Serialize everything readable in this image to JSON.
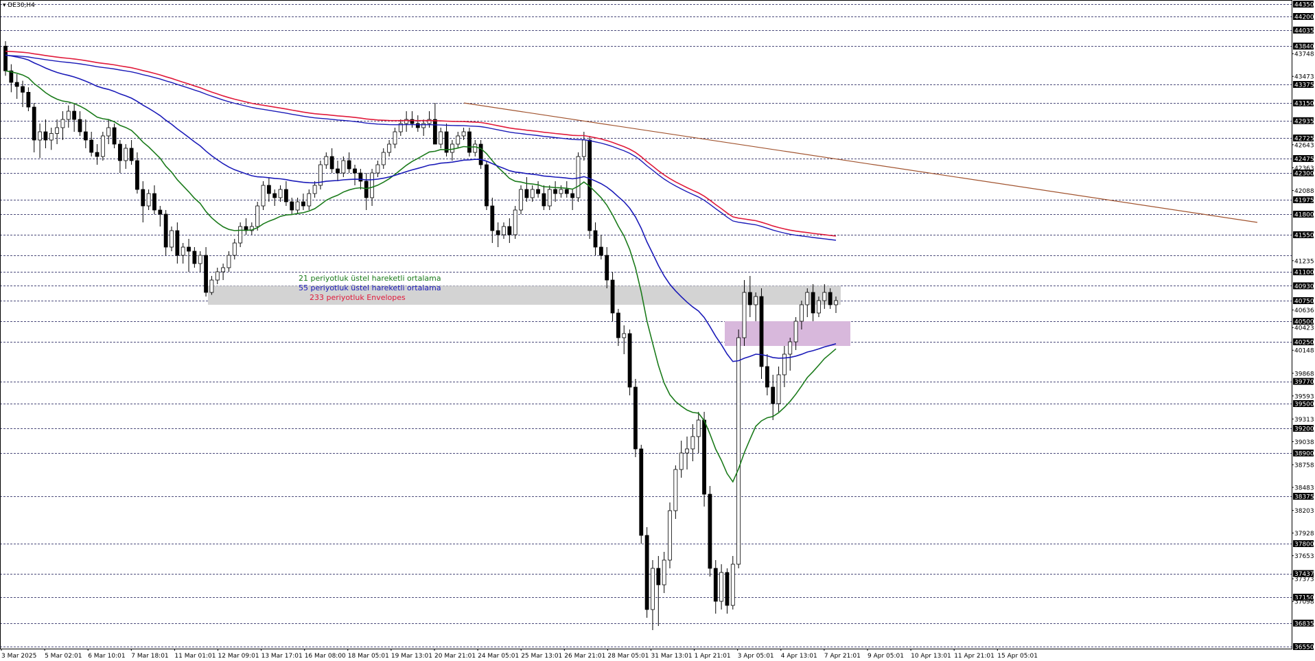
{
  "chart_data": {
    "type": "candlestick",
    "symbol": "DE30,H4",
    "y_tick_labels": [
      44350,
      44200,
      44035,
      43840,
      43748,
      43473,
      43375,
      43150,
      42935,
      42725,
      42643,
      42475,
      42363,
      42300,
      42088,
      41975,
      41800,
      41550,
      41235,
      41100,
      40930,
      40750,
      40636,
      40500,
      40423,
      40250,
      40148,
      39868,
      39770,
      39593,
      39500,
      39313,
      39200,
      39038,
      38900,
      38758,
      38483,
      38375,
      38203,
      37928,
      37800,
      37653,
      37437,
      37373,
      37150,
      37098,
      36835,
      36550
    ],
    "y_highlighted_levels": [
      44350,
      44200,
      44035,
      43840,
      43375,
      43150,
      42935,
      42725,
      42475,
      42300,
      41975,
      41800,
      41550,
      41300,
      41100,
      40930,
      40750,
      40500,
      40250,
      39770,
      39500,
      39200,
      38900,
      38375,
      37800,
      37437,
      37150,
      36835,
      36550
    ],
    "ylim": [
      36550,
      44350
    ],
    "x_tick_labels": [
      "3 Mar 2025",
      "5 Mar 02:01",
      "6 Mar 10:01",
      "7 Mar 18:01",
      "11 Mar 01:01",
      "12 Mar 09:01",
      "13 Mar 17:01",
      "16 Mar 08:00",
      "18 Mar 05:01",
      "19 Mar 13:01",
      "20 Mar 21:01",
      "24 Mar 05:01",
      "25 Mar 13:01",
      "26 Mar 21:01",
      "28 Mar 05:01",
      "31 Mar 13:01",
      "1 Apr 21:01",
      "3 Apr 05:01",
      "4 Apr 13:01",
      "7 Apr 21:01",
      "9 Apr 05:01",
      "10 Apr 13:01",
      "11 Apr 21:01",
      "15 Apr 05:01"
    ],
    "grid": true,
    "colors": {
      "bull_body": "#ffffff",
      "bear_body": "#000000",
      "wick": "#000000",
      "ema21": "#1a7a1a",
      "ema55": "#1a1ab8",
      "envelope": "#e0193a",
      "trendline": "#a0522d",
      "support_zone": "#d3d3d3",
      "demand_zone": "#d8b8dc",
      "highlight_label_bg": "#000000"
    },
    "legend": [
      {
        "text": "21 periyotluk üstel hareketli ortalama",
        "color": "#1a7a1a"
      },
      {
        "text": "55 periyotluk üstel hareketli ortalama",
        "color": "#1a1ab8"
      },
      {
        "text": "233 periyotluk Envelopes",
        "color": "#e0193a"
      }
    ],
    "candles_ohlc": [
      [
        43840,
        43900,
        43480,
        43540
      ],
      [
        43540,
        43620,
        43280,
        43400
      ],
      [
        43400,
        43500,
        43200,
        43350
      ],
      [
        43350,
        43420,
        43100,
        43280
      ],
      [
        43280,
        43340,
        43050,
        43100
      ],
      [
        43100,
        43150,
        42550,
        42700
      ],
      [
        42700,
        42900,
        42480,
        42800
      ],
      [
        42800,
        42950,
        42600,
        42700
      ],
      [
        42700,
        42850,
        42580,
        42780
      ],
      [
        42780,
        42950,
        42650,
        42850
      ],
      [
        42850,
        43050,
        42700,
        42950
      ],
      [
        42950,
        43120,
        42850,
        43050
      ],
      [
        43050,
        43150,
        42800,
        42950
      ],
      [
        42950,
        43050,
        42750,
        42800
      ],
      [
        42800,
        42950,
        42600,
        42700
      ],
      [
        42700,
        42800,
        42500,
        42550
      ],
      [
        42550,
        42650,
        42400,
        42500
      ],
      [
        42500,
        42800,
        42450,
        42750
      ],
      [
        42750,
        42950,
        42650,
        42850
      ],
      [
        42850,
        42900,
        42600,
        42650
      ],
      [
        42650,
        42700,
        42300,
        42450
      ],
      [
        42450,
        42650,
        42350,
        42600
      ],
      [
        42600,
        42700,
        42400,
        42450
      ],
      [
        42450,
        42550,
        42050,
        42100
      ],
      [
        42100,
        42200,
        41700,
        41900
      ],
      [
        41900,
        42100,
        41850,
        42050
      ],
      [
        42050,
        42150,
        41800,
        41850
      ],
      [
        41850,
        41900,
        41650,
        41800
      ],
      [
        41800,
        41850,
        41300,
        41400
      ],
      [
        41400,
        41650,
        41350,
        41600
      ],
      [
        41600,
        41700,
        41200,
        41300
      ],
      [
        41300,
        41450,
        41200,
        41400
      ],
      [
        41400,
        41500,
        41100,
        41350
      ],
      [
        41350,
        41400,
        41150,
        41200
      ],
      [
        41200,
        41350,
        41100,
        41300
      ],
      [
        41300,
        41400,
        40800,
        40850
      ],
      [
        40850,
        41050,
        40820,
        41000
      ],
      [
        41000,
        41150,
        40950,
        41100
      ],
      [
        41100,
        41200,
        41000,
        41150
      ],
      [
        41150,
        41350,
        41100,
        41300
      ],
      [
        41300,
        41500,
        41250,
        41450
      ],
      [
        41450,
        41700,
        41400,
        41650
      ],
      [
        41650,
        41750,
        41550,
        41600
      ],
      [
        41600,
        41700,
        41550,
        41650
      ],
      [
        41650,
        41950,
        41600,
        41900
      ],
      [
        41900,
        42200,
        41850,
        42150
      ],
      [
        42150,
        42250,
        41950,
        42050
      ],
      [
        42050,
        42100,
        41900,
        42000
      ],
      [
        42000,
        42150,
        41950,
        42100
      ],
      [
        42100,
        42200,
        41900,
        41950
      ],
      [
        41950,
        42000,
        41800,
        41850
      ],
      [
        41850,
        42000,
        41800,
        41950
      ],
      [
        41950,
        42050,
        41850,
        41900
      ],
      [
        41900,
        42100,
        41850,
        42050
      ],
      [
        42050,
        42200,
        42000,
        42150
      ],
      [
        42150,
        42450,
        42100,
        42400
      ],
      [
        42400,
        42550,
        42350,
        42500
      ],
      [
        42500,
        42600,
        42300,
        42350
      ],
      [
        42350,
        42450,
        42200,
        42300
      ],
      [
        42300,
        42500,
        42250,
        42450
      ],
      [
        42450,
        42550,
        42300,
        42350
      ],
      [
        42350,
        42400,
        42150,
        42300
      ],
      [
        42300,
        42350,
        42100,
        42200
      ],
      [
        42200,
        42300,
        41850,
        42000
      ],
      [
        42000,
        42350,
        41900,
        42300
      ],
      [
        42300,
        42450,
        42250,
        42400
      ],
      [
        42400,
        42600,
        42350,
        42550
      ],
      [
        42550,
        42700,
        42500,
        42650
      ],
      [
        42650,
        42850,
        42600,
        42800
      ],
      [
        42800,
        42950,
        42750,
        42900
      ],
      [
        42900,
        43050,
        42800,
        42950
      ],
      [
        42950,
        43050,
        42850,
        42900
      ],
      [
        42900,
        43000,
        42800,
        42850
      ],
      [
        42850,
        42950,
        42750,
        42900
      ],
      [
        42900,
        43050,
        42850,
        42950
      ],
      [
        42950,
        43150,
        42750,
        42650
      ],
      [
        42650,
        42850,
        42600,
        42800
      ],
      [
        42800,
        42900,
        42500,
        42550
      ],
      [
        42550,
        42700,
        42450,
        42650
      ],
      [
        42650,
        42800,
        42600,
        42750
      ],
      [
        42750,
        42850,
        42700,
        42800
      ],
      [
        42800,
        42850,
        42500,
        42550
      ],
      [
        42550,
        42700,
        42500,
        42650
      ],
      [
        42650,
        42700,
        42350,
        42400
      ],
      [
        42400,
        42450,
        41850,
        41900
      ],
      [
        41900,
        42000,
        41450,
        41600
      ],
      [
        41600,
        41700,
        41400,
        41550
      ],
      [
        41550,
        41700,
        41500,
        41650
      ],
      [
        41650,
        41750,
        41450,
        41550
      ],
      [
        41550,
        41900,
        41500,
        41850
      ],
      [
        41850,
        42150,
        41800,
        42100
      ],
      [
        42100,
        42250,
        41950,
        42000
      ],
      [
        42000,
        42150,
        41950,
        42100
      ],
      [
        42100,
        42200,
        42000,
        42050
      ],
      [
        42050,
        42150,
        41850,
        41900
      ],
      [
        41900,
        42150,
        41850,
        42100
      ],
      [
        42100,
        42200,
        41950,
        42050
      ],
      [
        42050,
        42150,
        42000,
        42100
      ],
      [
        42100,
        42200,
        42000,
        42050
      ],
      [
        42050,
        42100,
        41850,
        42000
      ],
      [
        42000,
        42550,
        41950,
        42500
      ],
      [
        42500,
        42800,
        42450,
        42700
      ],
      [
        42700,
        42750,
        41500,
        41600
      ],
      [
        41600,
        41700,
        41300,
        41400
      ],
      [
        41400,
        41550,
        41250,
        41300
      ],
      [
        41300,
        41400,
        40900,
        41000
      ],
      [
        41000,
        41100,
        40500,
        40600
      ],
      [
        40600,
        40650,
        40200,
        40300
      ],
      [
        40300,
        40450,
        40100,
        40350
      ],
      [
        40350,
        40400,
        39600,
        39700
      ],
      [
        39700,
        39800,
        38850,
        38950
      ],
      [
        38950,
        39000,
        37800,
        37900
      ],
      [
        37900,
        38000,
        36900,
        37000
      ],
      [
        37000,
        37600,
        36750,
        37500
      ],
      [
        37500,
        37650,
        36800,
        37300
      ],
      [
        37300,
        37700,
        37200,
        37600
      ],
      [
        37600,
        38300,
        37500,
        38200
      ],
      [
        38200,
        38750,
        38100,
        38700
      ],
      [
        38700,
        39050,
        38600,
        38900
      ],
      [
        38900,
        39100,
        38700,
        38950
      ],
      [
        38950,
        39250,
        38800,
        39100
      ],
      [
        39100,
        39400,
        38900,
        39300
      ],
      [
        39300,
        39400,
        38250,
        38400
      ],
      [
        38400,
        38500,
        37400,
        37500
      ],
      [
        37500,
        37600,
        36950,
        37100
      ],
      [
        37100,
        37550,
        37000,
        37450
      ],
      [
        37450,
        37500,
        36950,
        37050
      ],
      [
        37050,
        37650,
        37000,
        37550
      ],
      [
        37550,
        40400,
        37500,
        40300
      ],
      [
        40300,
        41000,
        40200,
        40850
      ],
      [
        40850,
        41050,
        40550,
        40700
      ],
      [
        40700,
        40850,
        40500,
        40800
      ],
      [
        40800,
        40900,
        39800,
        39950
      ],
      [
        39950,
        40100,
        39600,
        39700
      ],
      [
        39700,
        39850,
        39300,
        39500
      ],
      [
        39500,
        39950,
        39400,
        39850
      ],
      [
        39850,
        40200,
        39700,
        40100
      ],
      [
        40100,
        40300,
        39900,
        40250
      ],
      [
        40250,
        40550,
        40150,
        40500
      ],
      [
        40500,
        40750,
        40400,
        40700
      ],
      [
        40700,
        40900,
        40550,
        40850
      ],
      [
        40850,
        40950,
        40500,
        40600
      ],
      [
        40600,
        40800,
        40550,
        40750
      ],
      [
        40750,
        40950,
        40650,
        40850
      ],
      [
        40850,
        40900,
        40650,
        40700
      ],
      [
        40700,
        40800,
        40600,
        40750
      ]
    ]
  }
}
